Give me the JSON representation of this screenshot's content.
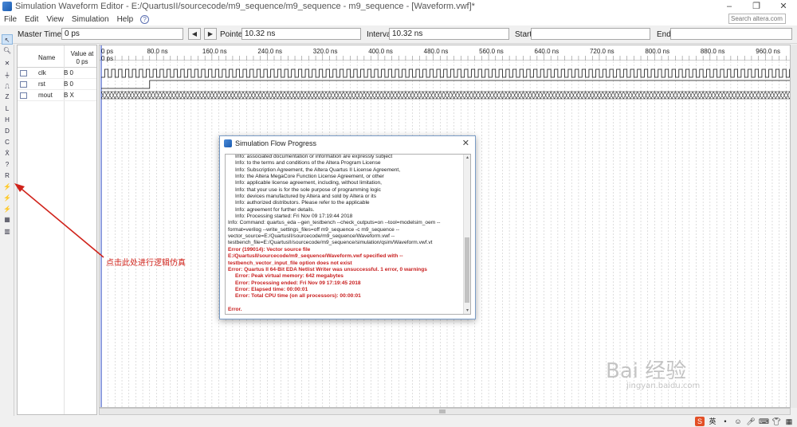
{
  "window": {
    "title": "Simulation Waveform Editor - E:/QuartusII/sourcecode/m9_sequence/m9_sequence - m9_sequence - [Waveform.vwf]*",
    "minimize": "–",
    "restore": "❐",
    "close": "✕"
  },
  "menu": {
    "items": [
      "File",
      "Edit",
      "View",
      "Simulation",
      "Help"
    ],
    "search_placeholder": "Search altera.com"
  },
  "toolbar": {
    "master_time_bar_label": "Master Time Bar:",
    "master_time_bar_value": "0 ps",
    "prev_label": "◀",
    "next_label": "▶",
    "pointer_label": "Pointer:",
    "pointer_value": "10.32 ns",
    "interval_label": "Interval:",
    "interval_value": "10.32 ns",
    "start_label": "Start:",
    "start_value": "",
    "end_label": "End:",
    "end_value": ""
  },
  "signals": {
    "header_name": "Name",
    "header_value": "Value at 0 ps",
    "rows": [
      {
        "name": "clk",
        "value": "B 0"
      },
      {
        "name": "rst",
        "value": "B 0"
      },
      {
        "name": "mout",
        "value": "B X"
      }
    ]
  },
  "ruler": {
    "labels": [
      "0 ps",
      "80.0 ns",
      "160.0 ns",
      "240.0 ns",
      "320.0 ns",
      "400.0 ns",
      "480.0 ns",
      "560.0 ns",
      "640.0 ns",
      "720.0 ns",
      "800.0 ns",
      "880.0 ns",
      "960.0 ns"
    ],
    "cursor_label": "0 ps"
  },
  "waveform": {
    "clk_period_ns": 10,
    "rst_high_from_ns": 70,
    "time_span_ns": 1000
  },
  "annotation": {
    "text": "点击此处进行逻辑仿真",
    "color": "#d0231b"
  },
  "dialog": {
    "title": "Simulation Flow Progress",
    "close": "✕",
    "lines": [
      {
        "text": "Info: associated documentation or information are expressly subject",
        "cls": "ind"
      },
      {
        "text": "Info: to the terms and conditions of the Altera Program License",
        "cls": "ind"
      },
      {
        "text": "Info: Subscription Agreement, the Altera Quartus II License Agreement,",
        "cls": "ind"
      },
      {
        "text": "Info: the Altera MegaCore Function License Agreement, or other",
        "cls": "ind"
      },
      {
        "text": "Info: applicable license agreement, including, without limitation,",
        "cls": "ind"
      },
      {
        "text": "Info: that your use is for the sole purpose of programming logic",
        "cls": "ind"
      },
      {
        "text": "Info: devices manufactured by Altera and sold by Altera or its",
        "cls": "ind"
      },
      {
        "text": "Info: authorized distributors.  Please refer to the applicable",
        "cls": "ind"
      },
      {
        "text": "Info: agreement for further details.",
        "cls": "ind"
      },
      {
        "text": "Info: Processing started: Fri Nov 09 17:19:44 2018",
        "cls": "ind"
      },
      {
        "text": "Info: Command: quartus_eda --gen_testbench --check_outputs=on --tool=modelsim_oem --",
        "cls": ""
      },
      {
        "text": "format=verilog --write_settings_files=off m9_sequence -c m9_sequence --",
        "cls": ""
      },
      {
        "text": "vector_source=E:/QuartusII/sourcecode/m9_sequence/Waveform.vwf --",
        "cls": ""
      },
      {
        "text": "testbench_file=E:/QuartusII/sourcecode/m9_sequence/simulation/qsim/Waveform.vwf.vt",
        "cls": ""
      },
      {
        "text": "Error (199014): Vector source file",
        "cls": "err"
      },
      {
        "text": "E:/QuartusII/sourcecode/m9_sequence/Waveform.vwf specified with --",
        "cls": "err"
      },
      {
        "text": "testbench_vector_input_file option does not exist",
        "cls": "err"
      },
      {
        "text": "Error: Quartus II 64-Bit EDA Netlist Writer was unsuccessful. 1 error, 0 warnings",
        "cls": "err"
      },
      {
        "text": "Error: Peak virtual memory: 642 megabytes",
        "cls": "err ind2"
      },
      {
        "text": "Error: Processing ended: Fri Nov 09 17:19:45 2018",
        "cls": "err ind2"
      },
      {
        "text": "Error: Elapsed time: 00:00:01",
        "cls": "err ind2"
      },
      {
        "text": "Error: Total CPU time (on all processors): 00:00:01",
        "cls": "err ind2"
      },
      {
        "text": "",
        "cls": ""
      },
      {
        "text": "Error.",
        "cls": "err"
      }
    ]
  },
  "watermark": {
    "main": "Bai 经验",
    "sub": "jingyan.baidu.com"
  },
  "tray": {
    "ime": "S",
    "lang": "英"
  }
}
